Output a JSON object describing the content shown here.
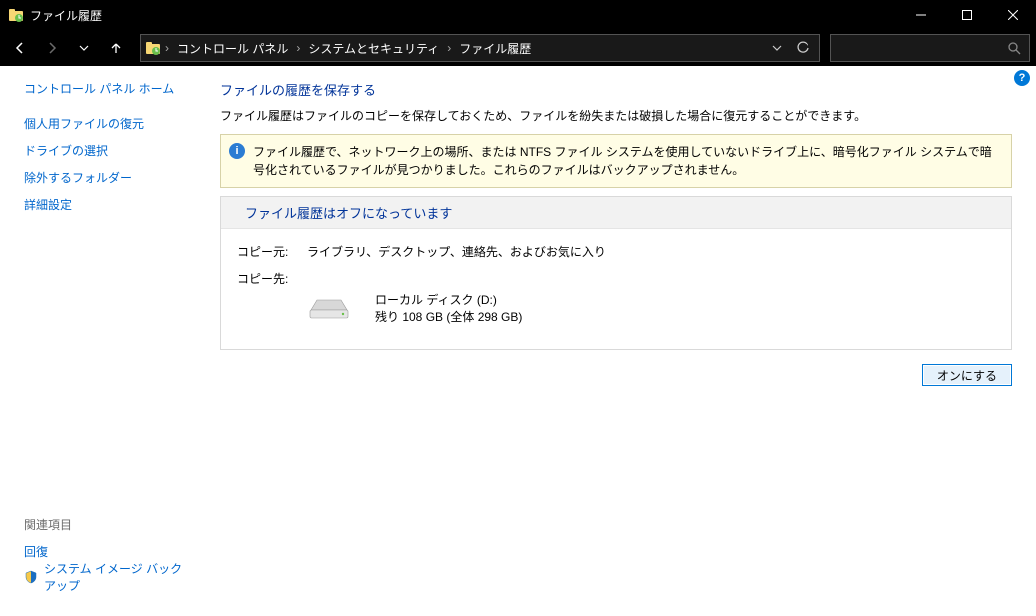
{
  "window": {
    "title": "ファイル履歴"
  },
  "breadcrumbs": {
    "root": "コントロール パネル",
    "cat": "システムとセキュリティ",
    "page": "ファイル履歴"
  },
  "sidebar": {
    "home": "コントロール パネル ホーム",
    "links": {
      "restore": "個人用ファイルの復元",
      "select_drive": "ドライブの選択",
      "exclude": "除外するフォルダー",
      "advanced": "詳細設定"
    },
    "related_header": "関連項目",
    "related": {
      "recovery": "回復",
      "sys_image": "システム イメージ バックアップ"
    }
  },
  "main": {
    "heading": "ファイルの履歴を保存する",
    "description": "ファイル履歴はファイルのコピーを保存しておくため、ファイルを紛失または破損した場合に復元することができます。",
    "info_notice": "ファイル履歴で、ネットワーク上の場所、または NTFS ファイル システムを使用していないドライブ上に、暗号化ファイル システムで暗号化されているファイルが見つかりました。これらのファイルはバックアップされません。",
    "status_header": "ファイル履歴はオフになっています",
    "copy_from_label": "コピー元:",
    "copy_from_value": "ライブラリ、デスクトップ、連絡先、およびお気に入り",
    "copy_to_label": "コピー先:",
    "dest_name": "ローカル ディスク (D:)",
    "dest_space": "残り 108 GB (全体 298 GB)",
    "turn_on_button": "オンにする"
  }
}
